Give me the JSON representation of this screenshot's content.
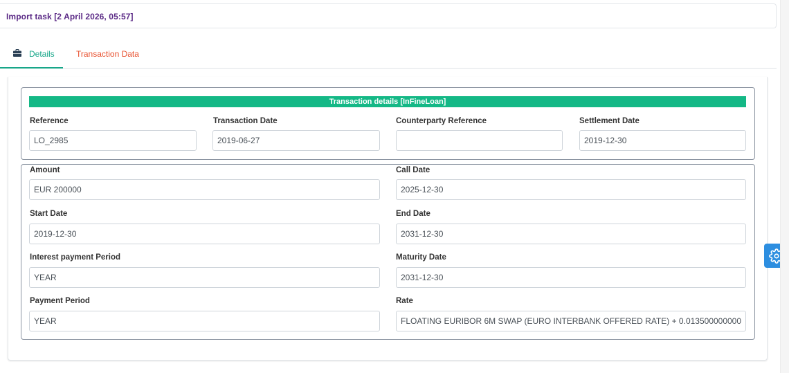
{
  "header": {
    "title": "Import task [2 April 2026, 05:57]"
  },
  "tabs": [
    {
      "label": "Details",
      "icon": "briefcase-icon",
      "active": true
    },
    {
      "label": "Transaction Data",
      "active": false
    }
  ],
  "section": {
    "title": "Transaction details [InFineLoan]"
  },
  "fields": {
    "reference": {
      "label": "Reference",
      "value": "LO_2985"
    },
    "transaction_date": {
      "label": "Transaction Date",
      "value": "2019-06-27"
    },
    "counterparty_reference": {
      "label": "Counterparty Reference",
      "value": ""
    },
    "settlement_date": {
      "label": "Settlement Date",
      "value": "2019-12-30"
    },
    "amount": {
      "label": "Amount",
      "value": "EUR 200000"
    },
    "call_date": {
      "label": "Call Date",
      "value": "2025-12-30"
    },
    "start_date": {
      "label": "Start Date",
      "value": "2019-12-30"
    },
    "end_date": {
      "label": "End Date",
      "value": "2031-12-30"
    },
    "interest_payment_period": {
      "label": "Interest payment Period",
      "value": "YEAR"
    },
    "maturity_date": {
      "label": "Maturity Date",
      "value": "2031-12-30"
    },
    "payment_period": {
      "label": "Payment Period",
      "value": "YEAR"
    },
    "rate": {
      "label": "Rate",
      "value": "FLOATING EURIBOR 6M SWAP (EURO INTERBANK OFFERED RATE) + 0.013500000000000"
    }
  },
  "settings_button": {
    "icon": "gear-icon"
  },
  "colors": {
    "accent": "#14b886",
    "title": "#5b2a86",
    "tab_inactive": "#e8502e",
    "settings": "#2d8ee0"
  }
}
